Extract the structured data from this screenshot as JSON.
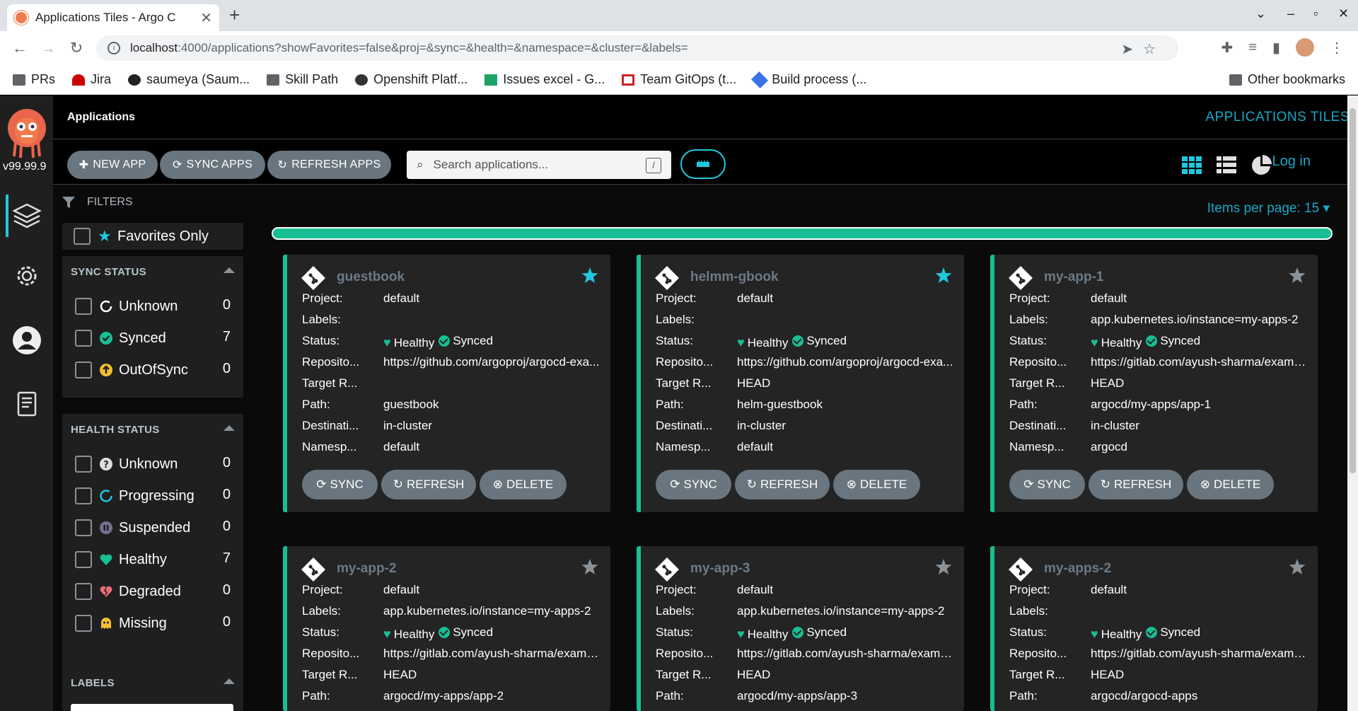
{
  "browser": {
    "tab_title": "Applications Tiles - Argo C",
    "url_host": "localhost",
    "url_rest": ":4000/applications?showFavorites=false&proj=&sync=&health=&namespace=&cluster=&labels=",
    "bookmarks": [
      "PRs",
      "Jira",
      "saumeya (Saum...",
      "Skill Path",
      "Openshift Platf...",
      "Issues excel - G...",
      "Team GitOps (t...",
      "Build process (..."
    ],
    "other_bookmarks": "Other bookmarks"
  },
  "sidenav": {
    "version": "v99.99.9"
  },
  "topbar": {
    "title": "Applications",
    "subtitle": "APPLICATIONS TILES"
  },
  "toolbar": {
    "new_app": "NEW APP",
    "sync_apps": "SYNC APPS",
    "refresh_apps": "REFRESH APPS",
    "search_placeholder": "Search applications...",
    "search_shortcut": "/",
    "login": "Log in"
  },
  "filters": {
    "header": "FILTERS",
    "favorites_only": "Favorites Only",
    "sync_status": {
      "title": "SYNC STATUS",
      "items": [
        {
          "label": "Unknown",
          "count": "0"
        },
        {
          "label": "Synced",
          "count": "7"
        },
        {
          "label": "OutOfSync",
          "count": "0"
        }
      ]
    },
    "health_status": {
      "title": "HEALTH STATUS",
      "items": [
        {
          "label": "Unknown",
          "count": "0"
        },
        {
          "label": "Progressing",
          "count": "0"
        },
        {
          "label": "Suspended",
          "count": "0"
        },
        {
          "label": "Healthy",
          "count": "7"
        },
        {
          "label": "Degraded",
          "count": "0"
        },
        {
          "label": "Missing",
          "count": "0"
        }
      ]
    },
    "labels": {
      "title": "LABELS"
    }
  },
  "items_per_page": "Items per page: 15",
  "field_labels": {
    "project": "Project:",
    "labels": "Labels:",
    "status": "Status:",
    "repo": "Reposito...",
    "target": "Target R...",
    "path": "Path:",
    "dest": "Destinati...",
    "ns": "Namesp..."
  },
  "status": {
    "health": "Healthy",
    "sync": "Synced"
  },
  "card_buttons": {
    "sync": "SYNC",
    "refresh": "REFRESH",
    "delete": "DELETE"
  },
  "apps": [
    {
      "name": "guestbook",
      "favorite": true,
      "project": "default",
      "labels": "",
      "repo": "https://github.com/argoproj/argocd-exa...",
      "target": "",
      "path": "guestbook",
      "dest": "in-cluster",
      "ns": "default"
    },
    {
      "name": "helmm-gbook",
      "favorite": true,
      "project": "default",
      "labels": "",
      "repo": "https://github.com/argoproj/argocd-exa...",
      "target": "HEAD",
      "path": "helm-guestbook",
      "dest": "in-cluster",
      "ns": "default"
    },
    {
      "name": "my-app-1",
      "favorite": false,
      "project": "default",
      "labels": "app.kubernetes.io/instance=my-apps-2",
      "repo": "https://gitlab.com/ayush-sharma/examp...",
      "target": "HEAD",
      "path": "argocd/my-apps/app-1",
      "dest": "in-cluster",
      "ns": "argocd"
    },
    {
      "name": "my-app-2",
      "favorite": false,
      "project": "default",
      "labels": "app.kubernetes.io/instance=my-apps-2",
      "repo": "https://gitlab.com/ayush-sharma/examp...",
      "target": "HEAD",
      "path": "argocd/my-apps/app-2"
    },
    {
      "name": "my-app-3",
      "favorite": false,
      "project": "default",
      "labels": "app.kubernetes.io/instance=my-apps-2",
      "repo": "https://gitlab.com/ayush-sharma/examp...",
      "target": "HEAD",
      "path": "argocd/my-apps/app-3"
    },
    {
      "name": "my-apps-2",
      "favorite": false,
      "project": "default",
      "labels": "",
      "repo": "https://gitlab.com/ayush-sharma/examp...",
      "target": "HEAD",
      "path": "argocd/argocd-apps"
    }
  ],
  "colors": {
    "accent": "#20c8e0",
    "healthy": "#18be94",
    "button": "#69767f",
    "card": "#242424"
  }
}
